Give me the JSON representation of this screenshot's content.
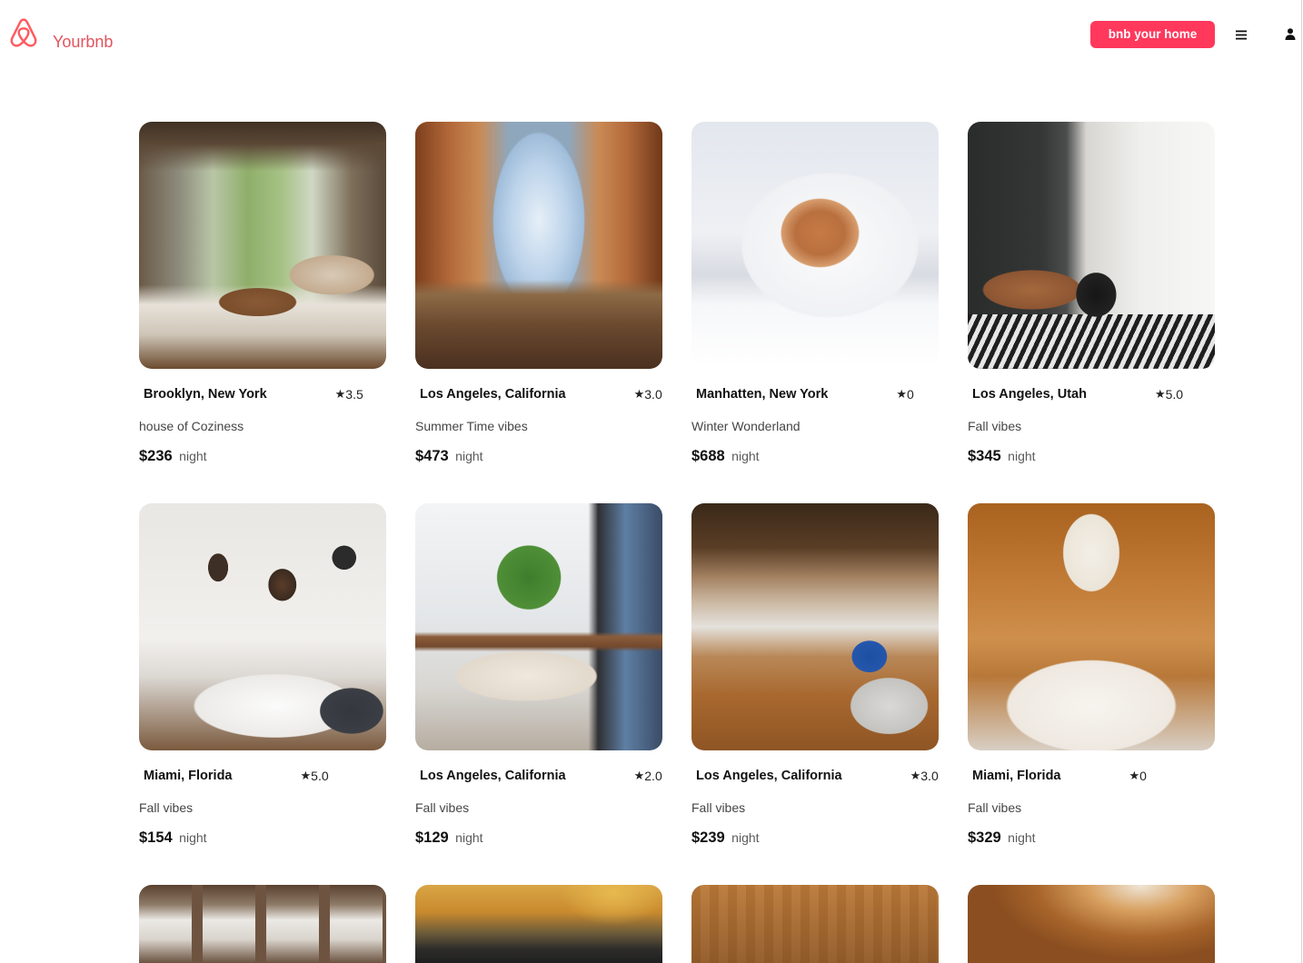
{
  "brand": {
    "name": "Yourbnb",
    "logo_icon": "airbnb-belo-icon",
    "color": "#FF5A5F"
  },
  "header": {
    "host_button_label": "bnb your home",
    "host_button_color": "#FF385C",
    "menu_icon": "hamburger-menu-icon",
    "profile_icon": "user-icon"
  },
  "rating_icon": "star-icon",
  "price_unit": "night",
  "listings": [
    {
      "location": "Brooklyn, New York",
      "rating": "3.5",
      "description": "house of Coziness",
      "price": "$236"
    },
    {
      "location": "Los Angeles, California",
      "rating": "3.0",
      "description": "Summer Time vibes",
      "price": "$473"
    },
    {
      "location": "Manhatten, New York",
      "rating": "0",
      "description": "Winter Wonderland",
      "price": "$688"
    },
    {
      "location": "Los Angeles, Utah",
      "rating": "5.0",
      "description": "Fall vibes",
      "price": "$345"
    },
    {
      "location": "Miami, Florida",
      "rating": "5.0",
      "description": "Fall vibes",
      "price": "$154"
    },
    {
      "location": "Los Angeles, California",
      "rating": "2.0",
      "description": "Fall vibes",
      "price": "$129"
    },
    {
      "location": "Los Angeles, California",
      "rating": "3.0",
      "description": "Fall vibes",
      "price": "$239"
    },
    {
      "location": "Miami, Florida",
      "rating": "0",
      "description": "Fall vibes",
      "price": "$329"
    }
  ]
}
